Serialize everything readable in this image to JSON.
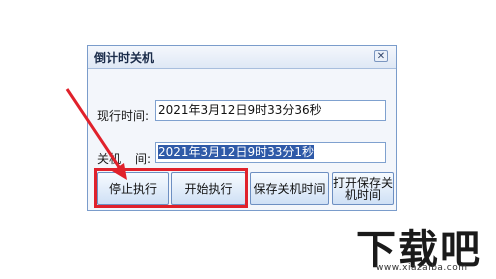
{
  "window": {
    "title": "倒计时关机",
    "close_icon_text": "✕"
  },
  "fields": {
    "current_time_label": "现行时间:",
    "current_time_value": "2021年3月12日9时33分36秒",
    "shutdown_time_label_left": "关机",
    "shutdown_time_label_right": "间:",
    "shutdown_time_value": "2021年3月12日9时33分1秒"
  },
  "buttons": {
    "stop": "停止执行",
    "start": "开始执行",
    "save_shutdown_time": "保存关机时间",
    "open_saved_line1": "打开保存关",
    "open_saved_line2": "机时间"
  },
  "watermark": {
    "brand": "下载吧",
    "url": "www.xiazaiba.com"
  },
  "colors": {
    "annotation_red": "#e0212b",
    "selection_blue": "#2f5aa8"
  }
}
